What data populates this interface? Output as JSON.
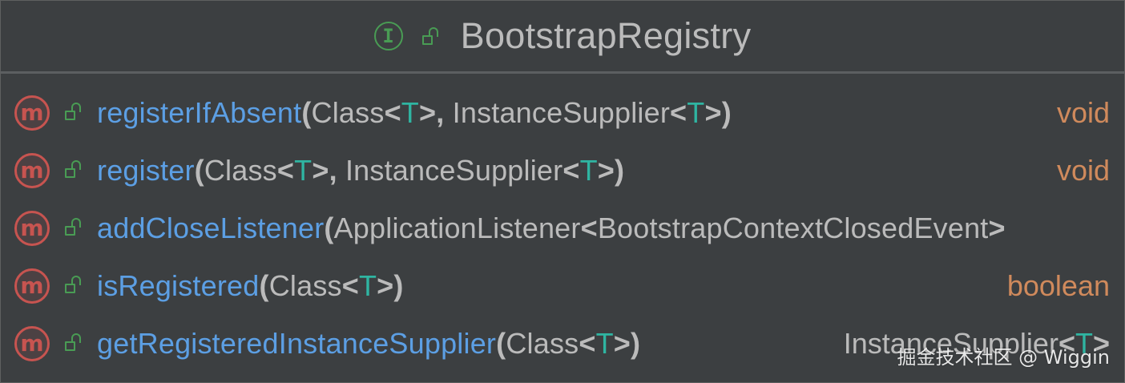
{
  "header": {
    "title": "BootstrapRegistry",
    "interface_icon_letter": "I",
    "interface_icon": "interface-icon",
    "visibility_icon": "unlocked-public-icon"
  },
  "colors": {
    "background": "#3c3f41",
    "method_name": "#5c9fe4",
    "type_param": "#2fb5a2",
    "return_type": "#d08a5c",
    "method_icon": "#c75450",
    "interface_icon": "#499c54"
  },
  "methods": [
    {
      "icon_letter": "m",
      "name": "registerIfAbsent",
      "open": "(",
      "p1": "Class",
      "p1_lt": "<",
      "p1_t": "T",
      "p1_gt": ">",
      "sep": ",",
      "p2": " InstanceSupplier",
      "p2_lt": "<",
      "p2_t": "T",
      "p2_gt": ">",
      "close": ")",
      "return": "void"
    },
    {
      "icon_letter": "m",
      "name": "register",
      "open": "(",
      "p1": "Class",
      "p1_lt": "<",
      "p1_t": "T",
      "p1_gt": ">",
      "sep": ",",
      "p2": " InstanceSupplier",
      "p2_lt": "<",
      "p2_t": "T",
      "p2_gt": ">",
      "close": ")",
      "return": "void"
    },
    {
      "icon_letter": "m",
      "name": "addCloseListener",
      "open": "(",
      "p1": "ApplicationListener",
      "p1_lt": "<",
      "p1_t": "BootstrapContextClosedEvent",
      "p1_gt": ">"
    },
    {
      "icon_letter": "m",
      "name": "isRegistered",
      "open": "(",
      "p1": "Class",
      "p1_lt": "<",
      "p1_t": "T",
      "p1_gt": ">",
      "close": ")",
      "return": "boolean"
    },
    {
      "icon_letter": "m",
      "name": "getRegisteredInstanceSupplier",
      "open": "(",
      "p1": "Class",
      "p1_lt": "<",
      "p1_t": "T",
      "p1_gt": ">",
      "close": ")",
      "return_base": "InstanceSupplier",
      "return_lt": "<",
      "return_t": "T",
      "return_gt": ">"
    }
  ],
  "watermark": "掘金技术社区 @ Wiggin"
}
